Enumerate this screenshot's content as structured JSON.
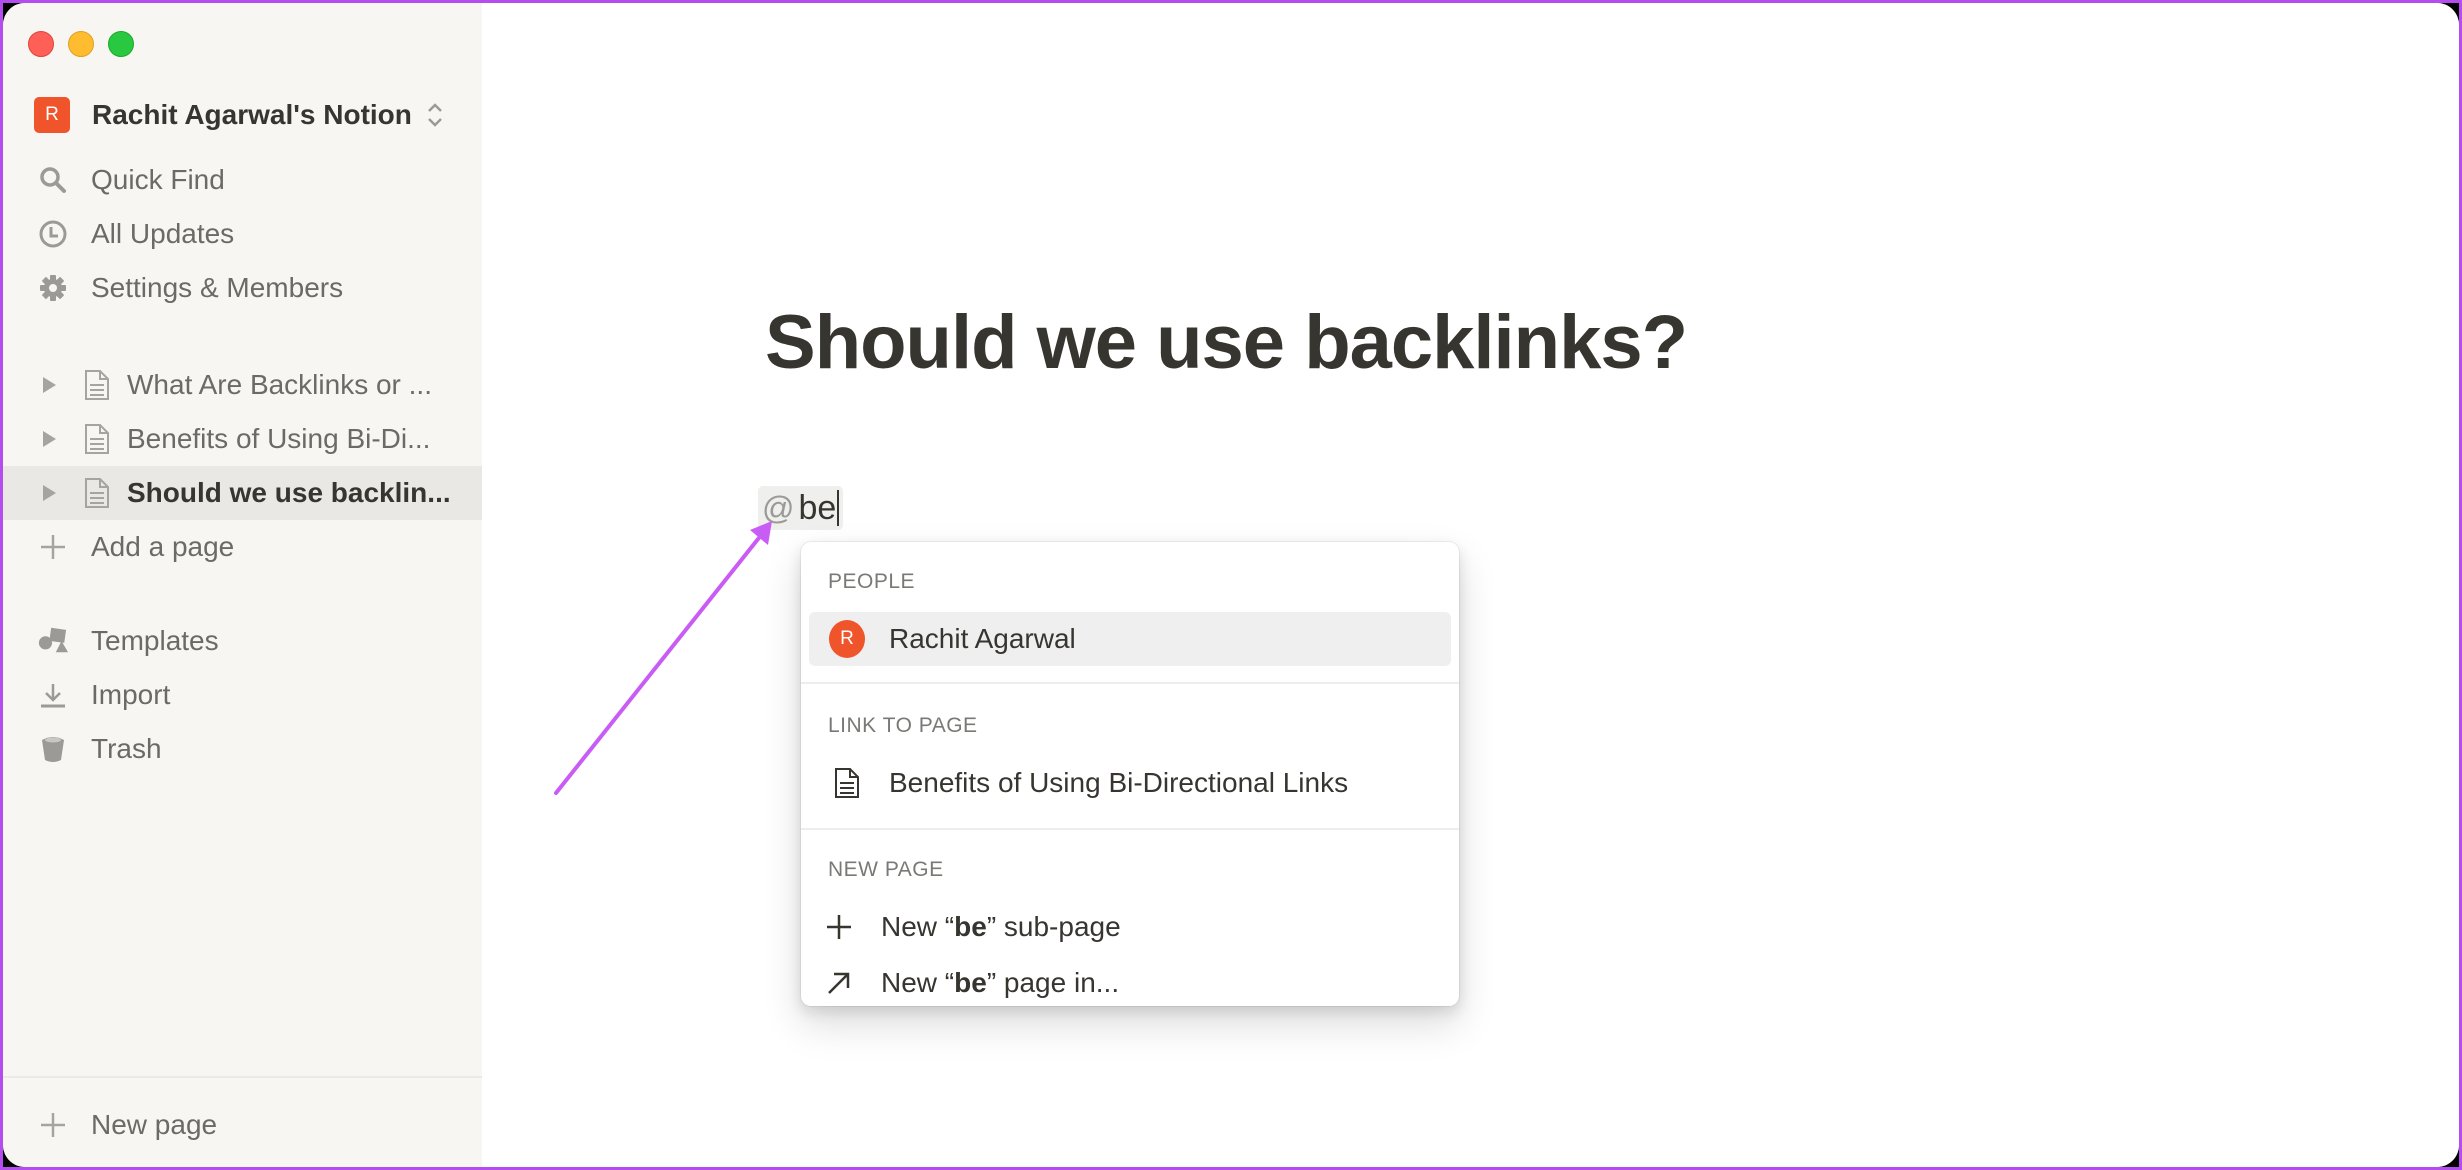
{
  "window": {
    "controls": [
      "close",
      "minimize",
      "maximize"
    ]
  },
  "sidebar": {
    "workspace": {
      "avatar_letter": "R",
      "name": "Rachit Agarwal's Notion",
      "avatar_color": "#f0542b"
    },
    "nav": [
      {
        "label": "Quick Find",
        "icon": "search-icon"
      },
      {
        "label": "All Updates",
        "icon": "clock-icon"
      },
      {
        "label": "Settings & Members",
        "icon": "gear-icon"
      }
    ],
    "pages": [
      {
        "label": "What Are Backlinks or ...",
        "selected": false
      },
      {
        "label": "Benefits of Using Bi-Di...",
        "selected": false
      },
      {
        "label": "Should we use backlin...",
        "selected": true
      }
    ],
    "add_page_label": "Add a page",
    "tools": [
      {
        "label": "Templates",
        "icon": "templates-icon"
      },
      {
        "label": "Import",
        "icon": "import-icon"
      },
      {
        "label": "Trash",
        "icon": "trash-icon"
      }
    ],
    "new_page_label": "New page"
  },
  "main": {
    "title": "Should we use backlinks?",
    "mention": {
      "trigger": "@",
      "query": "be"
    }
  },
  "popup": {
    "sections": [
      {
        "header": "PEOPLE",
        "items": [
          {
            "label": "Rachit Agarwal",
            "avatar_letter": "R",
            "highlighted": true
          }
        ]
      },
      {
        "header": "LINK TO PAGE",
        "items": [
          {
            "label": "Benefits of Using Bi-Directional Links",
            "icon": "page-icon"
          }
        ]
      },
      {
        "header": "NEW PAGE",
        "items": [
          {
            "prefix": "New “",
            "query": "be",
            "suffix": "” sub-page",
            "icon": "plus-icon"
          },
          {
            "prefix": "New “",
            "query": "be",
            "suffix": "” page in...",
            "icon": "arrow-up-right-icon"
          }
        ]
      }
    ]
  },
  "annotation": {
    "type": "arrow",
    "color": "#c95cf5",
    "points_to": "mention"
  }
}
